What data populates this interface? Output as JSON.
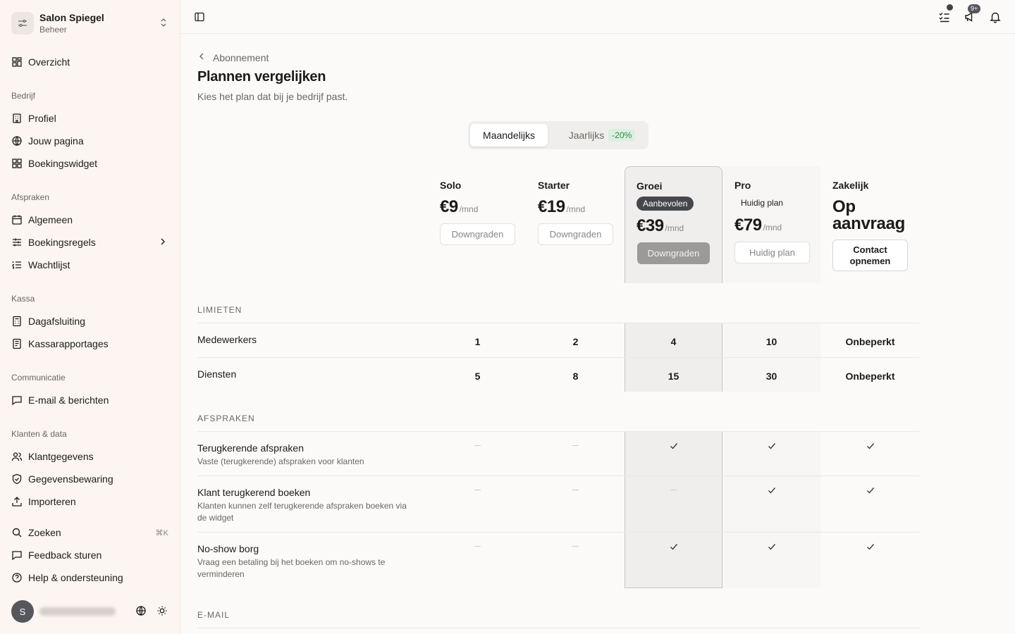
{
  "sidebar": {
    "org_name": "Salon Spiegel",
    "org_sub": "Beheer",
    "overview": "Overzicht",
    "sections": {
      "bedrijf": "Bedrijf",
      "afspraken": "Afspraken",
      "kassa": "Kassa",
      "communicatie": "Communicatie",
      "klanten": "Klanten & data"
    },
    "items": {
      "profiel": "Profiel",
      "jouw_pagina": "Jouw pagina",
      "boekingswidget": "Boekingswidget",
      "algemeen": "Algemeen",
      "boekingsregels": "Boekingsregels",
      "wachtlijst": "Wachtlijst",
      "dagafsluiting": "Dagafsluiting",
      "kassarapportages": "Kassarapportages",
      "email": "E-mail & berichten",
      "klantgegevens": "Klantgegevens",
      "gegevensbewaring": "Gegevensbewaring",
      "importeren": "Importeren",
      "zoeken": "Zoeken",
      "zoeken_kbd": "⌘K",
      "feedback": "Feedback sturen",
      "help": "Help & ondersteuning"
    },
    "user_initial": "S"
  },
  "topbar": {
    "badge": "9+"
  },
  "page": {
    "breadcrumb": "Abonnement",
    "title": "Plannen vergelijken",
    "subtitle": "Kies het plan dat bij je bedrijf past.",
    "billing": {
      "monthly": "Maandelijks",
      "yearly": "Jaarlijks",
      "discount": "-20%"
    }
  },
  "plans": [
    {
      "name": "Solo",
      "price": "€9",
      "period": "/mnd",
      "button": "Downgraden"
    },
    {
      "name": "Starter",
      "price": "€19",
      "period": "/mnd",
      "button": "Downgraden"
    },
    {
      "name": "Groei",
      "tag": "Aanbevolen",
      "price": "€39",
      "period": "/mnd",
      "button": "Downgraden"
    },
    {
      "name": "Pro",
      "tag": "Huidig plan",
      "price": "€79",
      "period": "/mnd",
      "button": "Huidig plan"
    },
    {
      "name": "Zakelijk",
      "price_line1": "Op",
      "price_line2": "aanvraag",
      "button_line1": "Contact",
      "button_line2": "opnemen"
    }
  ],
  "sections": {
    "limieten": "LIMIETEN",
    "afspraken": "AFSPRAKEN",
    "email": "E-MAIL"
  },
  "limits": [
    {
      "label": "Medewerkers",
      "values": [
        "1",
        "2",
        "4",
        "10",
        "Onbeperkt"
      ]
    },
    {
      "label": "Diensten",
      "values": [
        "5",
        "8",
        "15",
        "30",
        "Onbeperkt"
      ]
    }
  ],
  "features": [
    {
      "label": "Terugkerende afspraken",
      "desc": "Vaste (terugkerende) afspraken voor klanten",
      "included": [
        false,
        false,
        true,
        true,
        true
      ]
    },
    {
      "label": "Klant terugkerend boeken",
      "desc": "Klanten kunnen zelf terugkerende afspraken boeken via de widget",
      "included": [
        false,
        false,
        false,
        true,
        true
      ]
    },
    {
      "label": "No-show borg",
      "desc": "Vraag een betaling bij het boeken om no-shows te verminderen",
      "included": [
        false,
        false,
        true,
        true,
        true
      ]
    }
  ]
}
